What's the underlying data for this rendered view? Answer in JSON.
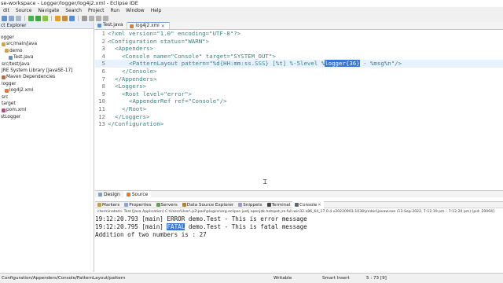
{
  "window": {
    "title": "se-workspace - Logger/logger/log4j2.xml - Eclipse IDE"
  },
  "menu": [
    "dit",
    "Source",
    "Navigate",
    "Search",
    "Project",
    "Run",
    "Window",
    "Help"
  ],
  "explorer": {
    "title": "ct Explorer",
    "items": [
      "ogger",
      "src/main/java",
      "demo",
      "Test.java",
      "src/test/java",
      "JRE System Library [JavaSE-17]",
      "Maven Dependencies",
      "logger",
      "log4j2.xml",
      "src",
      "target",
      "pom.xml",
      "stLogger"
    ]
  },
  "editor": {
    "tabs": [
      "Test.java",
      "log4j2.xml"
    ],
    "lines": [
      [
        "1",
        "<?xml version=\"1.0\" encoding=\"UTF-8\"?>"
      ],
      [
        "2",
        "<Configuration status=\"WARN\">"
      ],
      [
        "3",
        "<Appenders>"
      ],
      [
        "4",
        "<Console name=\"Console\" target=\"SYSTEM_OUT\">"
      ],
      [
        "5",
        "<PatternLayout pattern=\"%d{HH:mm:ss.SSS} [%t] %-5level %logger{36} - %msg%n\"/>"
      ],
      [
        "6",
        "</Console>"
      ],
      [
        "7",
        "</Appenders>"
      ],
      [
        "8",
        "<Loggers>"
      ],
      [
        "9",
        "<Root level=\"error\">"
      ],
      [
        "10",
        "<AppenderRef ref=\"Console\"/>"
      ],
      [
        "11",
        "</Root>"
      ],
      [
        "12",
        "</Loggers>"
      ],
      [
        "13",
        "</Configuration>"
      ]
    ],
    "selection": "logger{36}"
  },
  "bottom_tabs": [
    "Design",
    "Source"
  ],
  "console_tabs": [
    "Markers",
    "Properties",
    "Servers",
    "Data Source Explorer",
    "Snippets",
    "Terminal",
    "Console"
  ],
  "console": {
    "header": "<terminated> Test [Java Application] C:\\Users\\User\\.p2\\pool\\plugins\\org.eclipse.justj.openjdk.hotspot.jre.full.win32.x86_64_17.0.4.v20220903-1038\\jre\\bin\\javaw.exe  (13-Sep-2022, 7:12:19 pm – 7:12:20 pm) [pid: 20004]",
    "lines": [
      "19:12:20.793 [main] ERROR demo.Test - This is error message",
      "19:12:20.795 [main] FATAL demo.Test - This is fatal message",
      "Addition of two numbers is : 27"
    ],
    "selection": "FATAL"
  },
  "status": {
    "path": "Configuration/Appenders/Console/PatternLayout/pattern",
    "writable": "Writable",
    "insert_mode": "Smart Insert",
    "position": "5 : 73 [9]"
  },
  "colors": {
    "tag": "#3f7f7f",
    "attr": "#7f007f",
    "value": "#2a00ff",
    "selection": "#3875d7",
    "current_line": "#e8f2fe"
  }
}
